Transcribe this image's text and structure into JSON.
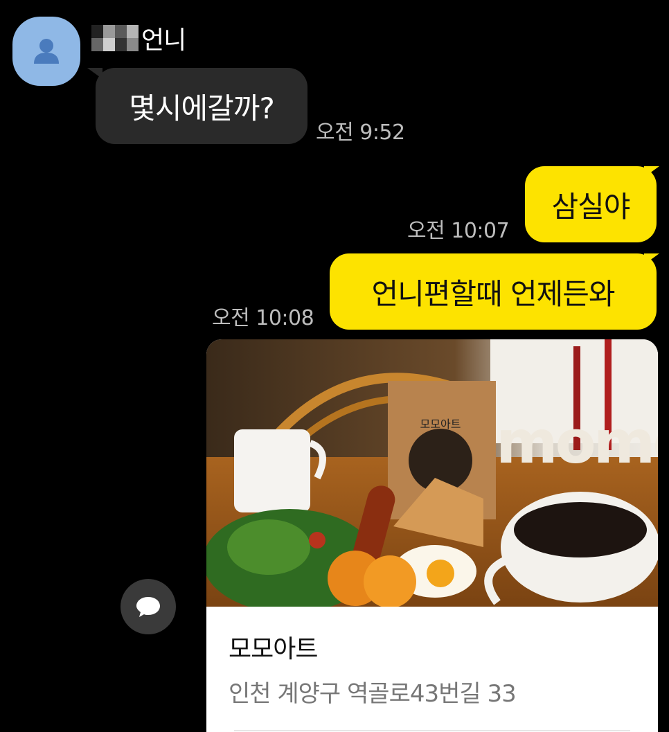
{
  "sender": {
    "name_suffix": "언니",
    "avatar_icon": "person-icon"
  },
  "messages": {
    "incoming": {
      "text": "몇시에갈까?",
      "time": "오전 9:52"
    },
    "outgoing_1": {
      "text": "삼실야",
      "time": "오전 10:07"
    },
    "outgoing_2": {
      "text": "언니편할때 언제든와",
      "time": "오전 10:08"
    }
  },
  "place_card": {
    "name": "모모아트",
    "address": "인천 계양구 역골로43번길 33",
    "photo_sign_text": "momo",
    "photo_bag_text": "모모아트"
  },
  "share_button": {
    "icon": "speech-bubble-icon"
  },
  "colors": {
    "background": "#000000",
    "incoming_bubble": "#2a2a2a",
    "outgoing_bubble": "#fde300",
    "avatar": "#8fb8e6"
  }
}
